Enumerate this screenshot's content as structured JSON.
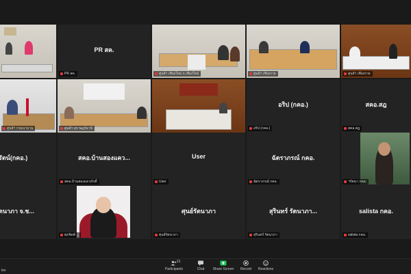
{
  "tiles": [
    {
      "id": 0,
      "type": "video",
      "tag": "",
      "name": ""
    },
    {
      "id": 1,
      "type": "name",
      "tag": "PR สค.",
      "name": "PR สค."
    },
    {
      "id": 2,
      "type": "video",
      "tag": "ศูนย์ฯ เชียงใหม่ จ.เชียงใหม่",
      "name": ""
    },
    {
      "id": 3,
      "type": "video",
      "tag": "ศูนย์ฯ เชียงราย",
      "name": ""
    },
    {
      "id": 4,
      "type": "video",
      "tag": "ศูนย์ฯ เชียงราย",
      "name": ""
    },
    {
      "id": 5,
      "type": "video",
      "tag": "ศูนย์ฯ กรมนาบาน",
      "name": ""
    },
    {
      "id": 6,
      "type": "video",
      "tag": "ศูนย์ฯ สุราษฎร์ธานี",
      "name": ""
    },
    {
      "id": 7,
      "type": "video",
      "tag": "",
      "name": ""
    },
    {
      "id": 8,
      "type": "name",
      "tag": "อริป (กคอ.)",
      "name": "อริป (กคอ.)"
    },
    {
      "id": 9,
      "type": "name",
      "tag": "สคอ.สฎ",
      "name": "สคอ.สฎ"
    },
    {
      "id": 10,
      "type": "name",
      "tag": "",
      "name": "รัตน์(กคอ.)"
    },
    {
      "id": 11,
      "type": "name",
      "tag": "สคอ.บ้านสองแควภักดิ์",
      "name": "สคอ.บ้านสองแคว..."
    },
    {
      "id": 12,
      "type": "name",
      "tag": "User",
      "name": "User"
    },
    {
      "id": 13,
      "type": "name",
      "tag": "ฉัตราภรณ์ กคอ.",
      "name": "ฉัตราภรณ์ กคอ."
    },
    {
      "id": 14,
      "type": "video",
      "tag": "ฯรัตนา กคอ.",
      "name": ""
    },
    {
      "id": 15,
      "type": "name",
      "tag": "",
      "name": "ตนาภา จ.ช..."
    },
    {
      "id": 16,
      "type": "video",
      "tag": "ศุภจิตต์ ...",
      "name": ""
    },
    {
      "id": 17,
      "type": "name",
      "tag": "ศุนย์รัตนาภา",
      "name": "ศุนย์รัตนาภา"
    },
    {
      "id": 18,
      "type": "name",
      "tag": "สุรินทร์ รัตนาภา",
      "name": "สุรินทร์    รัตนาภา..."
    },
    {
      "id": 19,
      "type": "name",
      "tag": "salista กคอ.",
      "name": "salista กคอ."
    }
  ],
  "toolbar": {
    "left_label": "les",
    "participants_label": "Participants",
    "participants_count": "21",
    "chat_label": "Chat",
    "share_label": "Share Screen",
    "record_label": "Record",
    "reactions_label": "Reactions",
    "share_color": "#24c35c"
  }
}
